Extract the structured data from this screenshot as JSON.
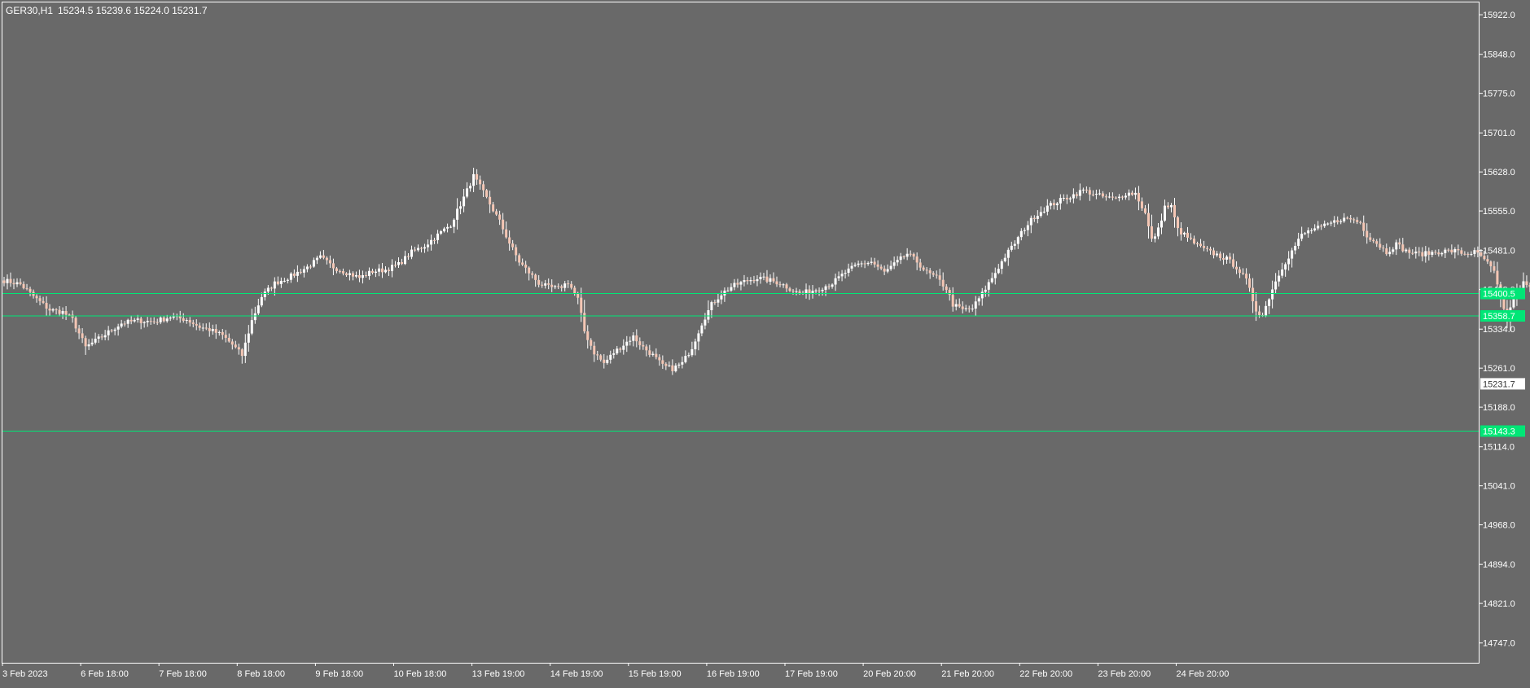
{
  "header": {
    "symbol": "GER30,H1",
    "ohlc": "15234.5 15239.6 15224.0 15231.7"
  },
  "colors": {
    "background": "#696969",
    "frame": "#ffffff",
    "text": "#ffffff",
    "bull_candle": "#ffffff",
    "bear_candle": "#f4c6b4",
    "hline": "#00e676",
    "hline_label_bg": "#00e676",
    "hline_label_text": "#ffffff",
    "price_label_bg": "#ffffff",
    "price_label_text": "#333333"
  },
  "chart_data": {
    "type": "candlestick",
    "ylim": [
      14710,
      15945
    ],
    "y_ticks": [
      "15922.0",
      "15848.0",
      "15775.0",
      "15701.0",
      "15628.0",
      "15555.0",
      "15481.0",
      "15408.0",
      "15334.0",
      "15261.0",
      "15188.0",
      "15114.0",
      "15041.0",
      "14968.0",
      "14894.0",
      "14821.0",
      "14747.0"
    ],
    "x_ticks": [
      "3 Feb 2023",
      "6 Feb 18:00",
      "7 Feb 18:00",
      "8 Feb 18:00",
      "9 Feb 18:00",
      "10 Feb 18:00",
      "13 Feb 19:00",
      "14 Feb 19:00",
      "15 Feb 19:00",
      "16 Feb 19:00",
      "17 Feb 19:00",
      "20 Feb 20:00",
      "21 Feb 20:00",
      "22 Feb 20:00",
      "23 Feb 20:00",
      "24 Feb 20:00"
    ],
    "bars_per_tick": 24,
    "current_price": "15231.7",
    "horizontal_lines": [
      {
        "value": 15400.5,
        "label": "15400.5"
      },
      {
        "value": 15358.7,
        "label": "15358.7"
      },
      {
        "value": 15143.3,
        "label": "15143.3"
      }
    ],
    "close_anchors": [
      [
        0,
        15425
      ],
      [
        5,
        15418
      ],
      [
        10,
        15390
      ],
      [
        14,
        15370
      ],
      [
        18,
        15366
      ],
      [
        21,
        15352
      ],
      [
        25,
        15300
      ],
      [
        30,
        15320
      ],
      [
        36,
        15345
      ],
      [
        41,
        15350
      ],
      [
        46,
        15348
      ],
      [
        51,
        15357
      ],
      [
        56,
        15352
      ],
      [
        60,
        15338
      ],
      [
        63,
        15333
      ],
      [
        67,
        15322
      ],
      [
        70,
        15305
      ],
      [
        73,
        15285
      ],
      [
        76,
        15350
      ],
      [
        79,
        15395
      ],
      [
        83,
        15420
      ],
      [
        88,
        15433
      ],
      [
        93,
        15450
      ],
      [
        97,
        15468
      ],
      [
        101,
        15450
      ],
      [
        105,
        15440
      ],
      [
        109,
        15430
      ],
      [
        113,
        15442
      ],
      [
        117,
        15445
      ],
      [
        121,
        15455
      ],
      [
        125,
        15478
      ],
      [
        129,
        15490
      ],
      [
        133,
        15510
      ],
      [
        137,
        15530
      ],
      [
        141,
        15580
      ],
      [
        144,
        15620
      ],
      [
        146,
        15600
      ],
      [
        149,
        15568
      ],
      [
        152,
        15535
      ],
      [
        155,
        15495
      ],
      [
        158,
        15460
      ],
      [
        161,
        15440
      ],
      [
        164,
        15420
      ],
      [
        167,
        15412
      ],
      [
        170,
        15410
      ],
      [
        173,
        15422
      ],
      [
        176,
        15390
      ],
      [
        178,
        15330
      ],
      [
        181,
        15290
      ],
      [
        184,
        15270
      ],
      [
        187,
        15290
      ],
      [
        190,
        15305
      ],
      [
        193,
        15320
      ],
      [
        196,
        15300
      ],
      [
        199,
        15285
      ],
      [
        202,
        15265
      ],
      [
        205,
        15260
      ],
      [
        208,
        15270
      ],
      [
        211,
        15300
      ],
      [
        214,
        15345
      ],
      [
        217,
        15380
      ],
      [
        220,
        15400
      ],
      [
        223,
        15413
      ],
      [
        227,
        15423
      ],
      [
        231,
        15430
      ],
      [
        235,
        15425
      ],
      [
        238,
        15420
      ],
      [
        241,
        15410
      ],
      [
        244,
        15400
      ],
      [
        247,
        15405
      ],
      [
        250,
        15410
      ],
      [
        254,
        15420
      ],
      [
        258,
        15440
      ],
      [
        262,
        15455
      ],
      [
        266,
        15460
      ],
      [
        270,
        15440
      ],
      [
        274,
        15460
      ],
      [
        277,
        15475
      ],
      [
        280,
        15460
      ],
      [
        283,
        15440
      ],
      [
        286,
        15430
      ],
      [
        289,
        15410
      ],
      [
        291,
        15380
      ],
      [
        294,
        15370
      ],
      [
        297,
        15373
      ],
      [
        300,
        15400
      ],
      [
        304,
        15440
      ],
      [
        307,
        15470
      ],
      [
        310,
        15495
      ],
      [
        313,
        15523
      ],
      [
        316,
        15545
      ],
      [
        320,
        15563
      ],
      [
        324,
        15575
      ],
      [
        328,
        15585
      ],
      [
        331,
        15594
      ],
      [
        335,
        15585
      ],
      [
        338,
        15580
      ],
      [
        341,
        15577
      ],
      [
        344,
        15588
      ],
      [
        347,
        15588
      ],
      [
        350,
        15550
      ],
      [
        352,
        15500
      ],
      [
        354,
        15520
      ],
      [
        356,
        15563
      ],
      [
        358,
        15563
      ],
      [
        360,
        15520
      ],
      [
        363,
        15505
      ],
      [
        366,
        15490
      ],
      [
        369,
        15480
      ],
      [
        372,
        15473
      ],
      [
        375,
        15465
      ],
      [
        378,
        15450
      ],
      [
        381,
        15425
      ],
      [
        384,
        15370
      ],
      [
        386,
        15360
      ],
      [
        389,
        15410
      ],
      [
        392,
        15450
      ],
      [
        395,
        15480
      ],
      [
        398,
        15510
      ],
      [
        401,
        15520
      ],
      [
        404,
        15524
      ],
      [
        407,
        15532
      ],
      [
        410,
        15540
      ],
      [
        413,
        15540
      ],
      [
        416,
        15533
      ],
      [
        418,
        15510
      ],
      [
        421,
        15495
      ],
      [
        424,
        15478
      ],
      [
        427,
        15493
      ],
      [
        430,
        15480
      ],
      [
        433,
        15475
      ],
      [
        436,
        15475
      ],
      [
        439,
        15478
      ],
      [
        442,
        15480
      ],
      [
        445,
        15480
      ],
      [
        448,
        15475
      ],
      [
        451,
        15478
      ],
      [
        454,
        15465
      ],
      [
        457,
        15440
      ],
      [
        459,
        15390
      ],
      [
        461,
        15350
      ],
      [
        463,
        15395
      ],
      [
        466,
        15420
      ],
      [
        469,
        15405
      ],
      [
        472,
        15405
      ],
      [
        474,
        15395
      ],
      [
        477,
        15375
      ],
      [
        480,
        15365
      ],
      [
        483,
        15363
      ],
      [
        486,
        15372
      ],
      [
        489,
        15375
      ],
      [
        492,
        15378
      ],
      [
        495,
        15380
      ],
      [
        498,
        15365
      ],
      [
        501,
        15345
      ],
      [
        503,
        15300
      ],
      [
        505,
        15275
      ],
      [
        507,
        15300
      ],
      [
        509,
        15345
      ],
      [
        512,
        15385
      ],
      [
        515,
        15420
      ],
      [
        518,
        15412
      ],
      [
        521,
        15410
      ],
      [
        524,
        15430
      ],
      [
        527,
        15440
      ],
      [
        530,
        15460
      ],
      [
        533,
        15470
      ],
      [
        536,
        15460
      ],
      [
        539,
        15445
      ],
      [
        542,
        15460
      ],
      [
        545,
        15480
      ],
      [
        548,
        15478
      ],
      [
        551,
        15468
      ],
      [
        553,
        15540
      ],
      [
        555,
        15500
      ],
      [
        558,
        15480
      ],
      [
        561,
        15510
      ],
      [
        564,
        15530
      ],
      [
        567,
        15525
      ],
      [
        570,
        15530
      ],
      [
        573,
        15538
      ],
      [
        576,
        15534
      ],
      [
        579,
        15530
      ],
      [
        582,
        15515
      ],
      [
        585,
        15490
      ],
      [
        588,
        15460
      ],
      [
        590,
        15420
      ],
      [
        592,
        15380
      ],
      [
        594,
        15320
      ],
      [
        596,
        15270
      ],
      [
        599,
        15240
      ],
      [
        602,
        15215
      ],
      [
        604,
        15220
      ],
      [
        606,
        15232
      ]
    ]
  }
}
